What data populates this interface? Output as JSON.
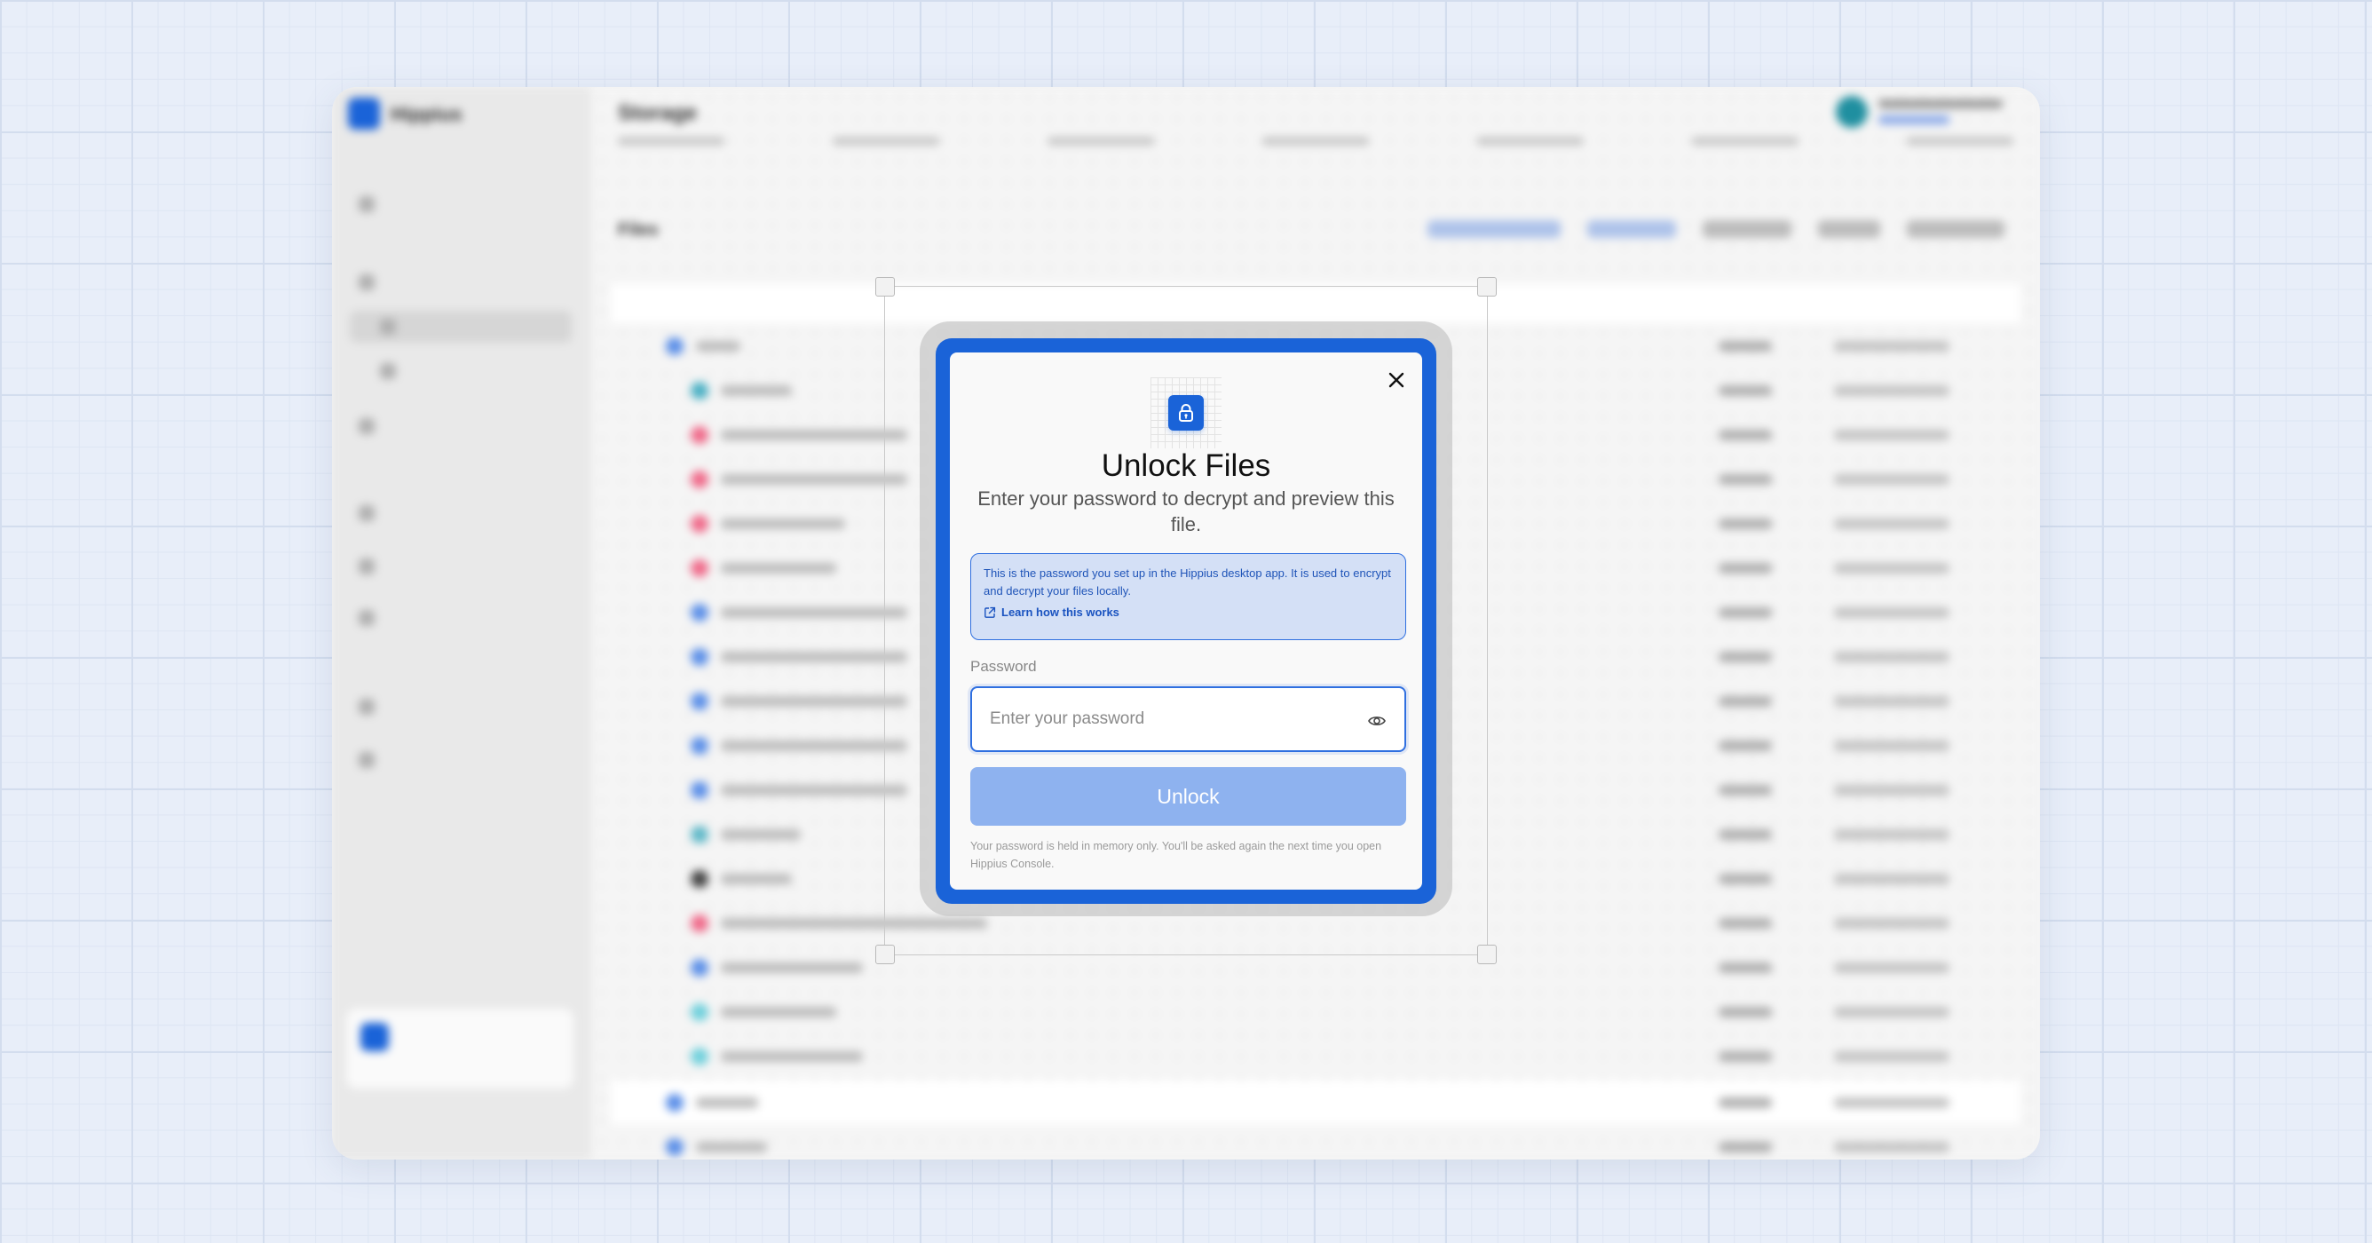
{
  "background_app": {
    "brand": "Hippius",
    "page_title": "Storage",
    "files_title": "Files"
  },
  "modal": {
    "title": "Unlock Files",
    "subtitle": "Enter your password to decrypt and preview this file.",
    "info": {
      "text": "This is the password you set up in the Hippius desktop app. It is used to encrypt and decrypt your files locally.",
      "link_label": "Learn how this works"
    },
    "password": {
      "label": "Password",
      "placeholder": "Enter your password",
      "value": ""
    },
    "unlock_label": "Unlock",
    "footnote": "Your password is held in memory only. You'll be asked again the next time you open Hippius Console."
  },
  "colors": {
    "accent": "#1a63d8",
    "info_bg": "#d4e0f6",
    "button_disabled": "#8eb2ef",
    "canvas_bg": "#e8eef9"
  },
  "icons": [
    "lock-icon",
    "close-icon",
    "external-link-icon",
    "eye-icon"
  ]
}
